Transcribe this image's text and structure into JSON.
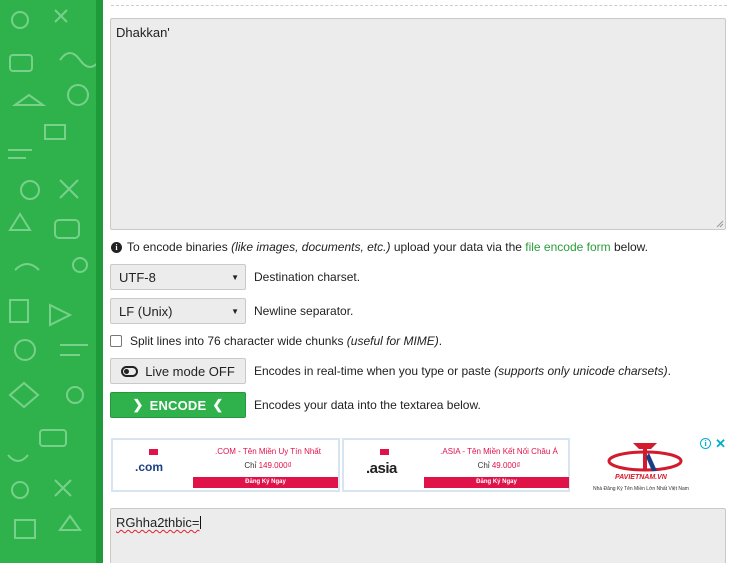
{
  "input": {
    "value": "Dhakkan'"
  },
  "info": {
    "prefix": "To encode binaries ",
    "italic": "(like images, documents, etc.)",
    "middle": " upload your data via the ",
    "link": "file encode form",
    "suffix": " below."
  },
  "charset": {
    "selected": "UTF-8",
    "description": "Destination charset."
  },
  "newline": {
    "selected": "LF (Unix)",
    "description": "Newline separator."
  },
  "split": {
    "label": "Split lines into 76 character wide chunks ",
    "note": "(useful for MIME)",
    "end": "."
  },
  "live_mode": {
    "label": "Live mode OFF",
    "description": "Encodes in real-time when you type or paste ",
    "note": "(supports only unicode charsets)",
    "end": "."
  },
  "encode": {
    "label": "ENCODE",
    "description": "Encodes your data into the textarea below."
  },
  "ad": {
    "card1": {
      "tld": ".com",
      "headline": ".COM - Tên Miền Uy Tín Nhất",
      "price_prefix": "Chỉ ",
      "price": "149.000₫",
      "cta": "Đăng Ký Ngay"
    },
    "card2": {
      "tld": ".asia",
      "headline": ".ASIA - Tên Miền Kết Nối Châu Á",
      "price_prefix": "Chỉ ",
      "price": "49.000₫",
      "cta": "Đăng Ký Ngay"
    },
    "brand": "PAVIETNAM.VN",
    "tagline": "Nhà Đăng Ký Tên Miền Lớn Nhất Việt Nam",
    "info_icon": "i",
    "close_icon": "✕"
  },
  "output": {
    "value": "RGhha2thbic="
  },
  "colors": {
    "accent": "#2fb24c",
    "link": "#2a9d3b",
    "ad_red": "#e0124a"
  }
}
